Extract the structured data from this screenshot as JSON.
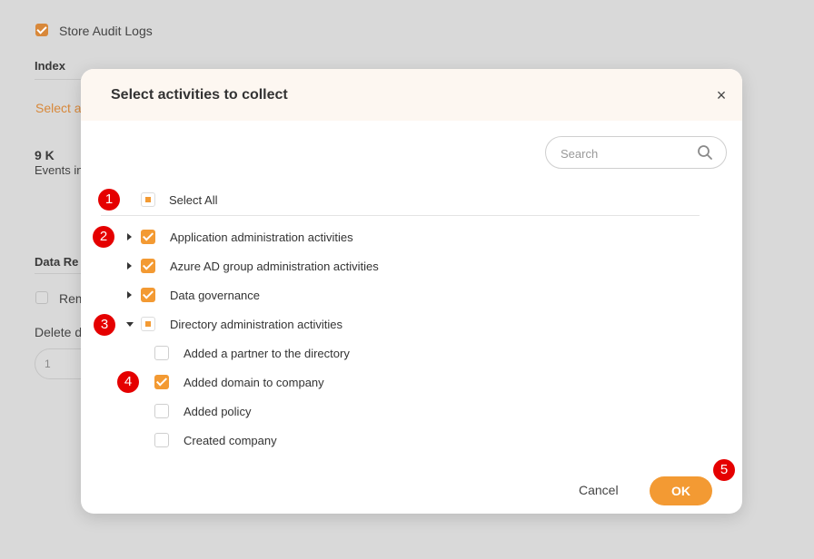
{
  "background": {
    "store_audit_logs_label": "Store Audit Logs",
    "index_heading": "Index",
    "select_link": "Select a",
    "count_value": "9 K",
    "events_label": "Events in",
    "data_retention_heading": "Data Re",
    "remove_label": "Rem",
    "delete_label": "Delete d",
    "number_input_value": "1"
  },
  "modal": {
    "title": "Select activities to collect",
    "close_glyph": "×",
    "search_placeholder": "Search",
    "select_all_label": "Select All",
    "groups": [
      {
        "label": "Application administration activities",
        "state": "checked",
        "expanded": false
      },
      {
        "label": "Azure AD group administration activities",
        "state": "checked",
        "expanded": false
      },
      {
        "label": "Data governance",
        "state": "checked",
        "expanded": false
      },
      {
        "label": "Directory administration activities",
        "state": "partial",
        "expanded": true
      }
    ],
    "children": [
      {
        "label": "Added a partner to the directory",
        "state": "unchecked"
      },
      {
        "label": "Added domain to company",
        "state": "checked"
      },
      {
        "label": "Added policy",
        "state": "unchecked"
      },
      {
        "label": "Created company",
        "state": "unchecked"
      }
    ],
    "cancel_label": "Cancel",
    "ok_label": "OK"
  },
  "markers": [
    "1",
    "2",
    "3",
    "4",
    "5"
  ],
  "colors": {
    "accent": "#f39a33",
    "marker": "#e50000",
    "header_bg": "#fdf7f1"
  },
  "icons": [
    "search-icon",
    "close-icon",
    "caret-right-icon",
    "caret-down-icon",
    "checkbox-checked",
    "checkbox-partial",
    "checkbox-unchecked"
  ]
}
